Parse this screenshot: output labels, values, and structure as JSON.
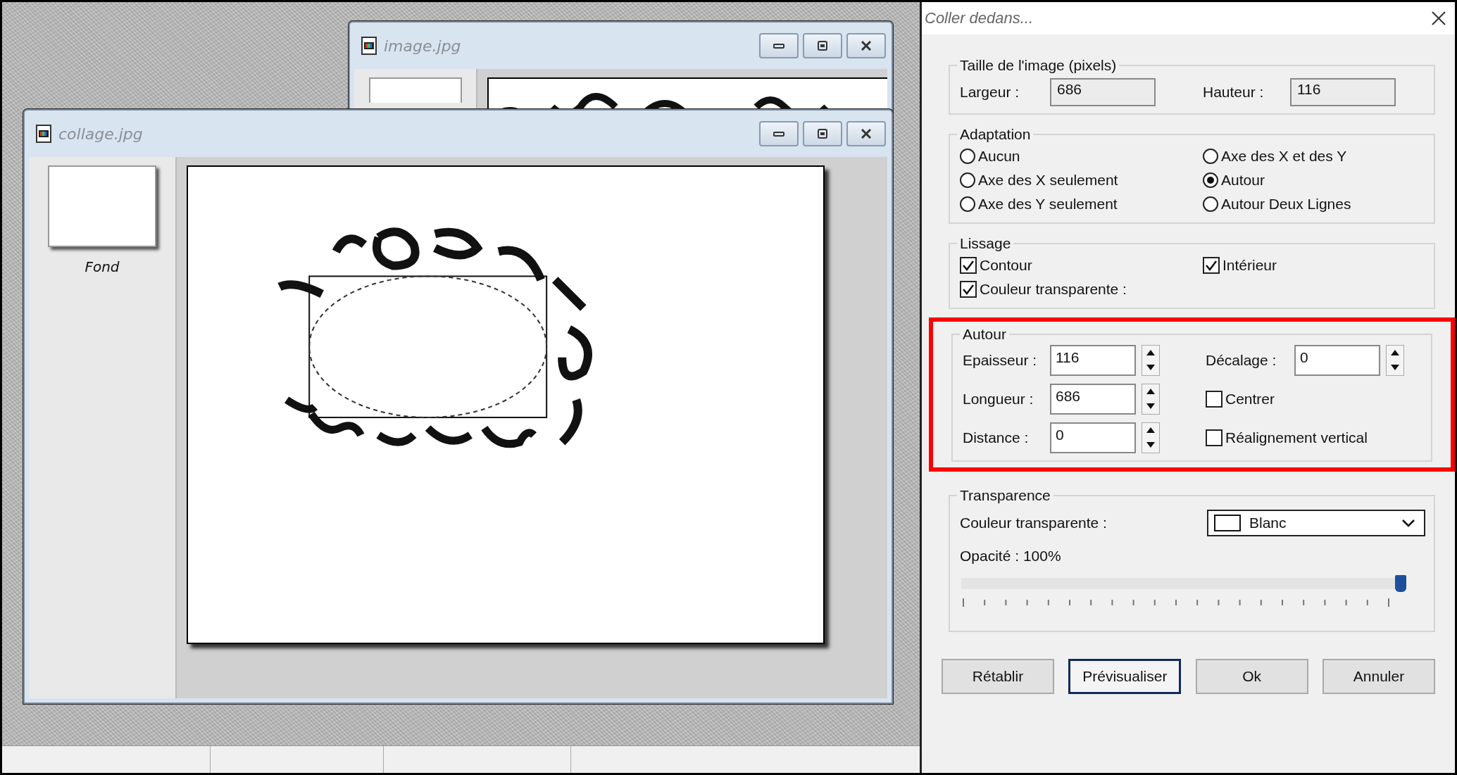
{
  "windows": [
    {
      "title": "image.jpg"
    },
    {
      "title": "collage.jpg",
      "layers": [
        {
          "name": "Fond"
        }
      ]
    }
  ],
  "dialog": {
    "title": "Coller dedans...",
    "size": {
      "legend": "Taille de l'image (pixels)",
      "fields": [
        {
          "label": "Largeur :",
          "value": "686"
        },
        {
          "label": "Hauteur :",
          "value": "116"
        }
      ]
    },
    "adaptation": {
      "legend": "Adaptation",
      "options": [
        {
          "label": "Aucun",
          "selected": false
        },
        {
          "label": "Axe des X et des Y",
          "selected": false
        },
        {
          "label": "Axe des X seulement",
          "selected": false
        },
        {
          "label": "Autour",
          "selected": true
        },
        {
          "label": "Axe des Y seulement",
          "selected": false
        },
        {
          "label": "Autour Deux Lignes",
          "selected": false
        }
      ]
    },
    "smoothing": {
      "legend": "Lissage",
      "options": [
        {
          "label": "Contour",
          "checked": true
        },
        {
          "label": "Intérieur",
          "checked": true
        },
        {
          "label": "Couleur transparente :",
          "checked": true
        }
      ]
    },
    "around": {
      "legend": "Autour",
      "highlighted": true,
      "items": [
        {
          "kind": "spinner",
          "label": "Epaisseur :",
          "value": "116"
        },
        {
          "kind": "spinner",
          "label": "Décalage :",
          "value": "0"
        },
        {
          "kind": "spinner",
          "label": "Longueur :",
          "value": "686"
        },
        {
          "kind": "checkbox",
          "label": "Centrer",
          "checked": false
        },
        {
          "kind": "spinner",
          "label": "Distance :",
          "value": "0"
        },
        {
          "kind": "checkbox",
          "label": "Réalignement vertical",
          "checked": false
        }
      ]
    },
    "transparency": {
      "legend": "Transparence",
      "color_label": "Couleur transparente :",
      "color_value": "Blanc",
      "opacity_label": "Opacité : 100%",
      "opacity": {
        "level": 1.0
      }
    },
    "buttons": [
      {
        "label": "Rétablir",
        "default": false
      },
      {
        "label": "Prévisualiser",
        "default": true
      },
      {
        "label": "Ok",
        "default": false
      },
      {
        "label": "Annuler",
        "default": false
      }
    ]
  }
}
